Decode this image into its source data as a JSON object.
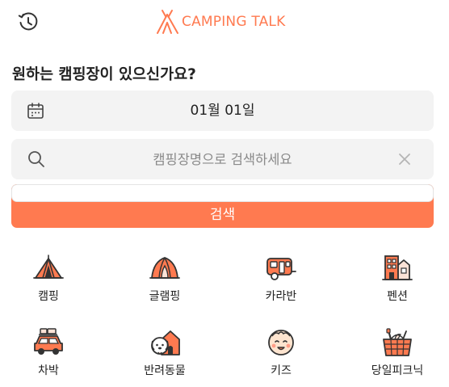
{
  "header": {
    "history_icon": "clock-history-icon",
    "logo_text": "CAMPING TALK",
    "brand_color": "#ff7a50"
  },
  "search": {
    "question": "원하는 캠핑장이 있으신가요?",
    "date_value": "01월 01일",
    "date_icon": "calendar-icon",
    "placeholder": "캠핑장명으로 검색하세요",
    "search_icon": "search-icon",
    "clear_icon": "close-icon",
    "button_label": "검색"
  },
  "categories": [
    {
      "label": "캠핑",
      "icon": "tent-icon"
    },
    {
      "label": "글램핑",
      "icon": "glamping-tent-icon"
    },
    {
      "label": "카라반",
      "icon": "caravan-icon"
    },
    {
      "label": "펜션",
      "icon": "pension-building-icon"
    },
    {
      "label": "차박",
      "icon": "car-camping-icon"
    },
    {
      "label": "반려동물",
      "icon": "pet-house-icon"
    },
    {
      "label": "키즈",
      "icon": "kid-face-icon"
    },
    {
      "label": "당일피크닉",
      "icon": "picnic-basket-icon"
    }
  ]
}
